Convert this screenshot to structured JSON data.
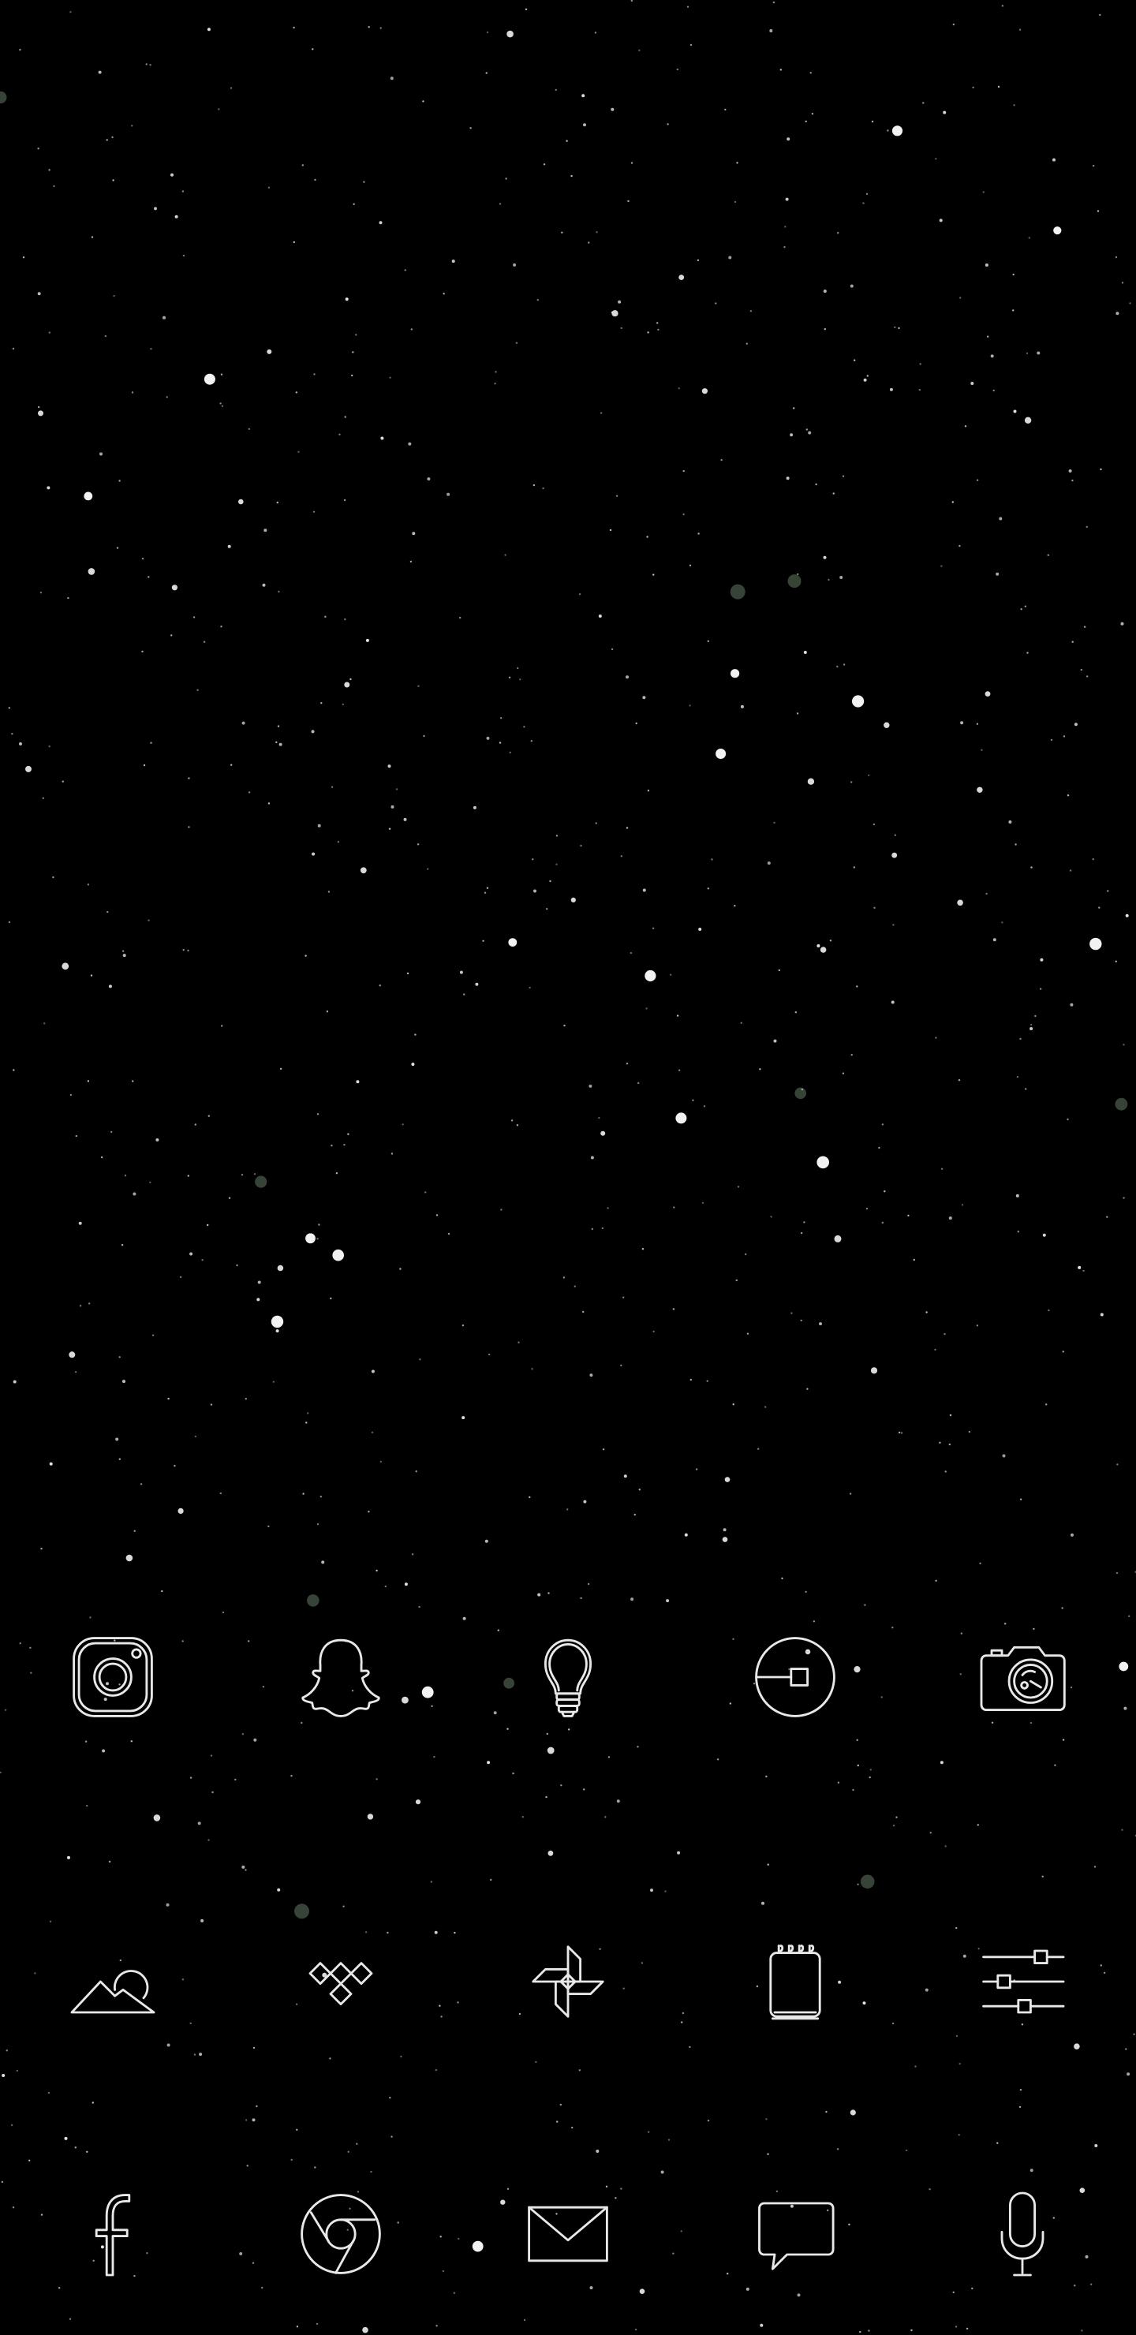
{
  "wallpaper": {
    "background_color": "#000000",
    "star_color": "#ffffff",
    "accent_star_color": "#9fbf9f"
  },
  "icon_stroke_color": "#e8e8e8",
  "home_screen": {
    "row1": [
      {
        "app": "Instagram",
        "icon": "instagram-icon"
      },
      {
        "app": "Snapchat",
        "icon": "snapchat-ghost-icon"
      },
      {
        "app": "Lightbulb",
        "icon": "lightbulb-icon"
      },
      {
        "app": "Uber",
        "icon": "uber-icon"
      },
      {
        "app": "Camera",
        "icon": "camera-icon"
      }
    ],
    "row2": [
      {
        "app": "Gallery",
        "icon": "gallery-icon"
      },
      {
        "app": "Tidal",
        "icon": "tidal-icon"
      },
      {
        "app": "Photos",
        "icon": "pinwheel-icon"
      },
      {
        "app": "Notes",
        "icon": "notepad-icon"
      },
      {
        "app": "Settings",
        "icon": "sliders-icon"
      }
    ]
  },
  "dock": [
    {
      "app": "Facebook",
      "icon": "facebook-icon"
    },
    {
      "app": "Chrome",
      "icon": "chrome-icon"
    },
    {
      "app": "Email",
      "icon": "envelope-icon"
    },
    {
      "app": "Messages",
      "icon": "chat-bubble-icon"
    },
    {
      "app": "Voice Search",
      "icon": "microphone-icon"
    }
  ]
}
